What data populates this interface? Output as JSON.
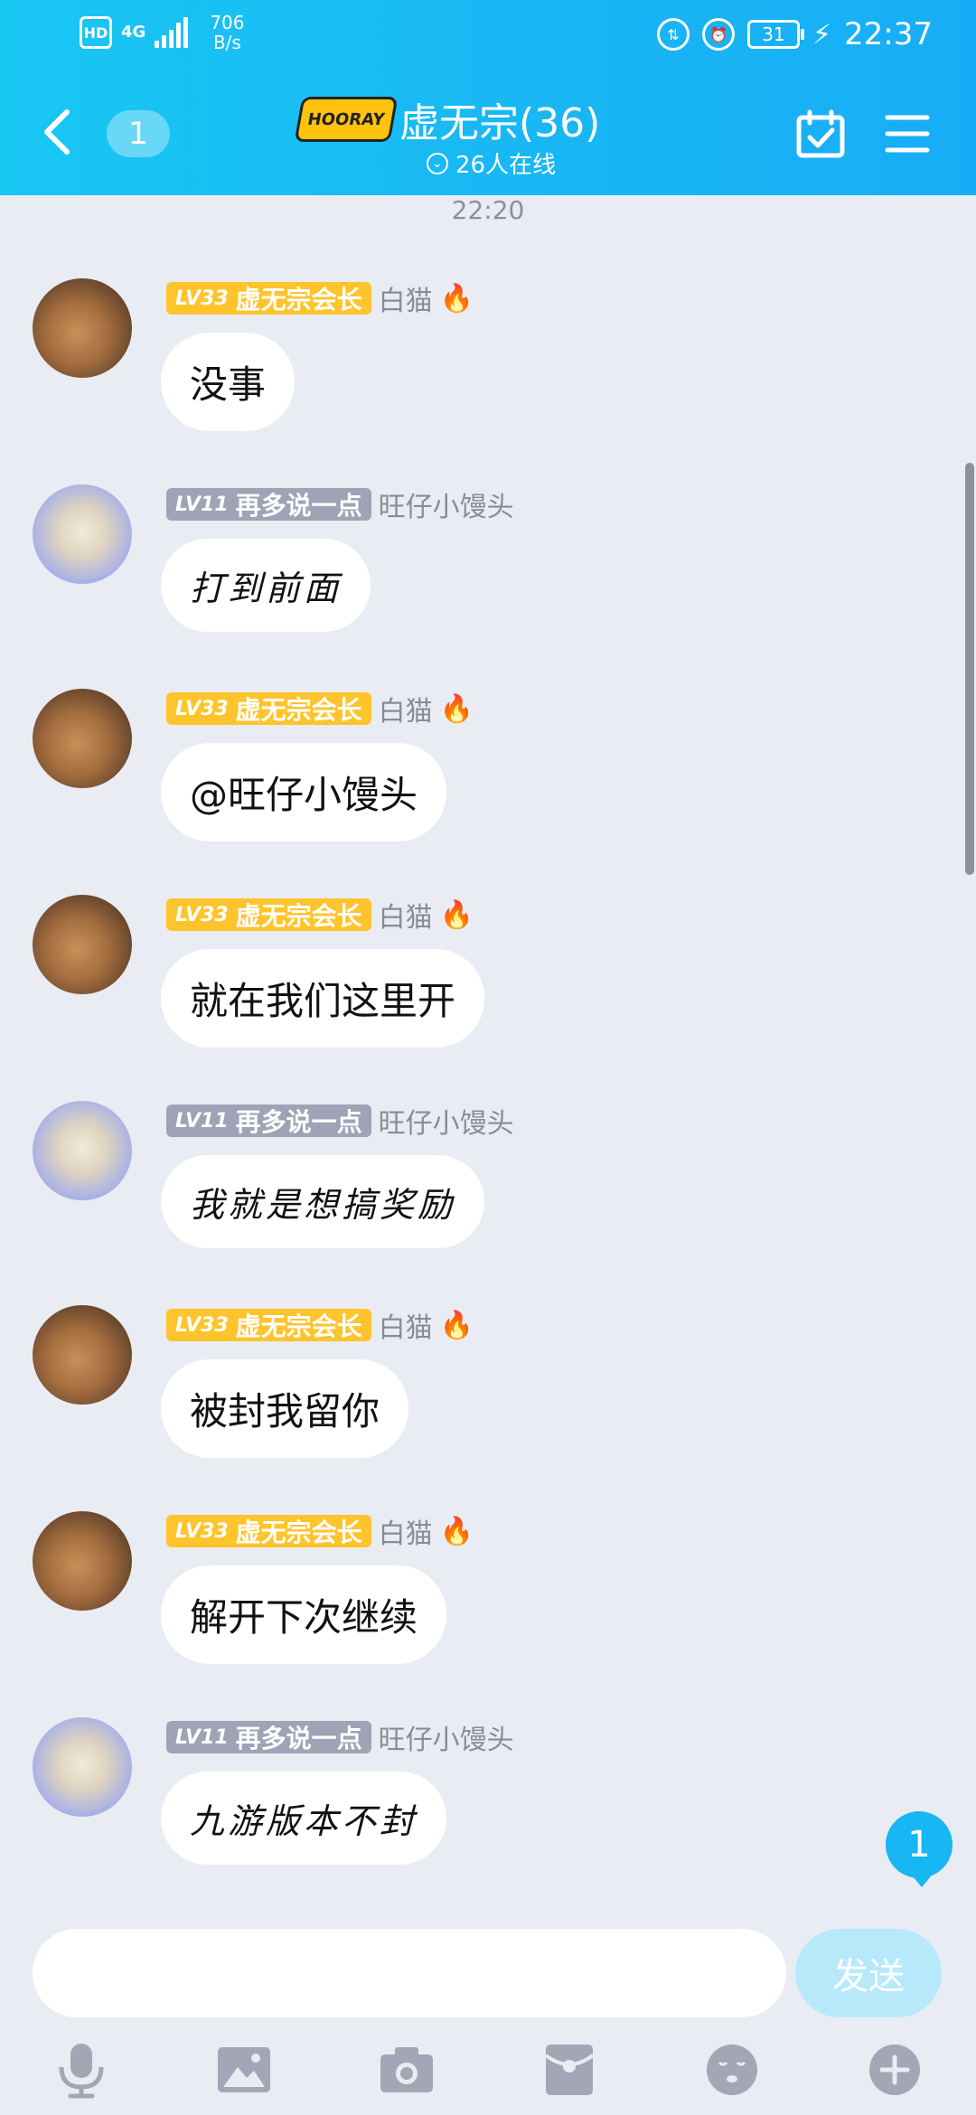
{
  "status_bar": {
    "hd": "HD",
    "network": "4G",
    "speed_value": "706",
    "speed_unit": "B/s",
    "battery": "31",
    "time": "22:37"
  },
  "header": {
    "back_unread": "1",
    "logo_text": "HOORAY",
    "title": "虚无宗(36)",
    "online": "26人在线"
  },
  "chat": {
    "timestamp": "22:20",
    "messages": [
      {
        "level": "LV33",
        "title": "虚无宗会长",
        "nick": "白猫",
        "text": "没事"
      },
      {
        "level": "LV11",
        "title": "再多说一点",
        "nick": "旺仔小馒头",
        "text": "打到前面"
      },
      {
        "level": "LV33",
        "title": "虚无宗会长",
        "nick": "白猫",
        "text": "@旺仔小馒头"
      },
      {
        "level": "LV33",
        "title": "虚无宗会长",
        "nick": "白猫",
        "text": "就在我们这里开"
      },
      {
        "level": "LV11",
        "title": "再多说一点",
        "nick": "旺仔小馒头",
        "text": "我就是想搞奖励"
      },
      {
        "level": "LV33",
        "title": "虚无宗会长",
        "nick": "白猫",
        "text": "被封我留你"
      },
      {
        "level": "LV33",
        "title": "虚无宗会长",
        "nick": "白猫",
        "text": "解开下次继续"
      },
      {
        "level": "LV11",
        "title": "再多说一点",
        "nick": "旺仔小馒头",
        "text": "九游版本不封"
      }
    ],
    "new_message_count": "1"
  },
  "input": {
    "value": "",
    "send_label": "发送"
  },
  "toolbar": [
    "microphone-icon",
    "image-icon",
    "camera-icon",
    "red-packet-icon",
    "emoji-icon",
    "plus-icon"
  ],
  "colors": {
    "header": "#19b8f4",
    "gold_badge": "#ffc42c",
    "gray_badge": "#9ea3b6",
    "background": "#eaecf4"
  }
}
